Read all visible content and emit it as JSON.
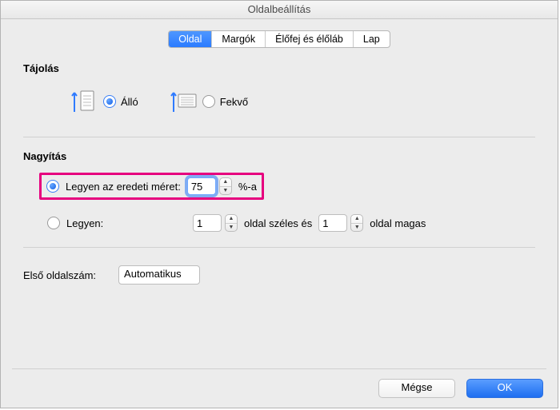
{
  "title": "Oldalbeállítás",
  "tabs": {
    "page": "Oldal",
    "margins": "Margók",
    "headerfooter": "Élőfej és élőláb",
    "sheet": "Lap"
  },
  "orientation": {
    "heading": "Tájolás",
    "portrait": "Álló",
    "landscape": "Fekvő",
    "selected": "portrait"
  },
  "zoom": {
    "heading": "Nagyítás",
    "adjust_label": "Legyen az eredeti méret:",
    "adjust_value": "75",
    "adjust_suffix": "%-a",
    "fit_label": "Legyen:",
    "fit_wide_value": "1",
    "fit_wide_suffix": "oldal széles és",
    "fit_tall_value": "1",
    "fit_tall_suffix": "oldal magas",
    "selected": "adjust"
  },
  "first_page": {
    "label": "Első oldalszám:",
    "value": "Automatikus"
  },
  "buttons": {
    "cancel": "Mégse",
    "ok": "OK"
  }
}
